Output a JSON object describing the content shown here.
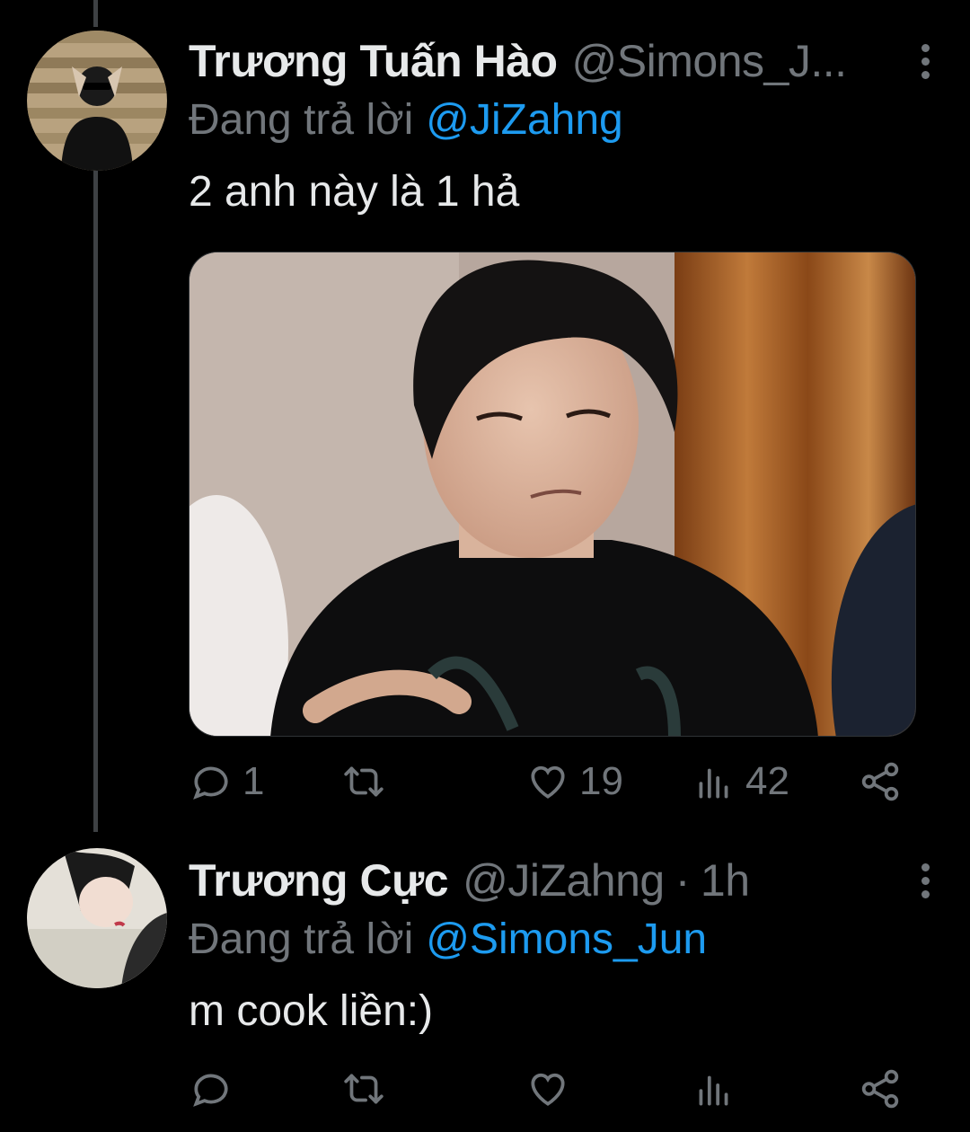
{
  "tweets": [
    {
      "display_name": "Trương Tuấn Hào",
      "handle": "@Simons_J...",
      "reply_prefix": "Đang trả lời",
      "reply_to": "@JiZahng",
      "text": "2 anh này là 1 hả",
      "has_media": true,
      "stats": {
        "replies": "1",
        "retweets": "",
        "likes": "19",
        "views": "42"
      }
    },
    {
      "display_name": "Trương Cực",
      "handle": "@JiZahng",
      "separator": "·",
      "time": "1h",
      "reply_prefix": "Đang trả lời",
      "reply_to": "@Simons_Jun",
      "text": "m cook liền:)",
      "has_media": false,
      "stats": {
        "replies": "",
        "retweets": "",
        "likes": "",
        "views": ""
      }
    }
  ],
  "icons": {
    "reply": "reply-icon",
    "retweet": "retweet-icon",
    "like": "heart-icon",
    "views": "views-icon",
    "share": "share-icon",
    "more": "more-vertical-icon"
  },
  "colors": {
    "background": "#000000",
    "text": "#e7e9ea",
    "muted": "#71767b",
    "link": "#1d9bf0",
    "thread_line": "#3e4144"
  }
}
